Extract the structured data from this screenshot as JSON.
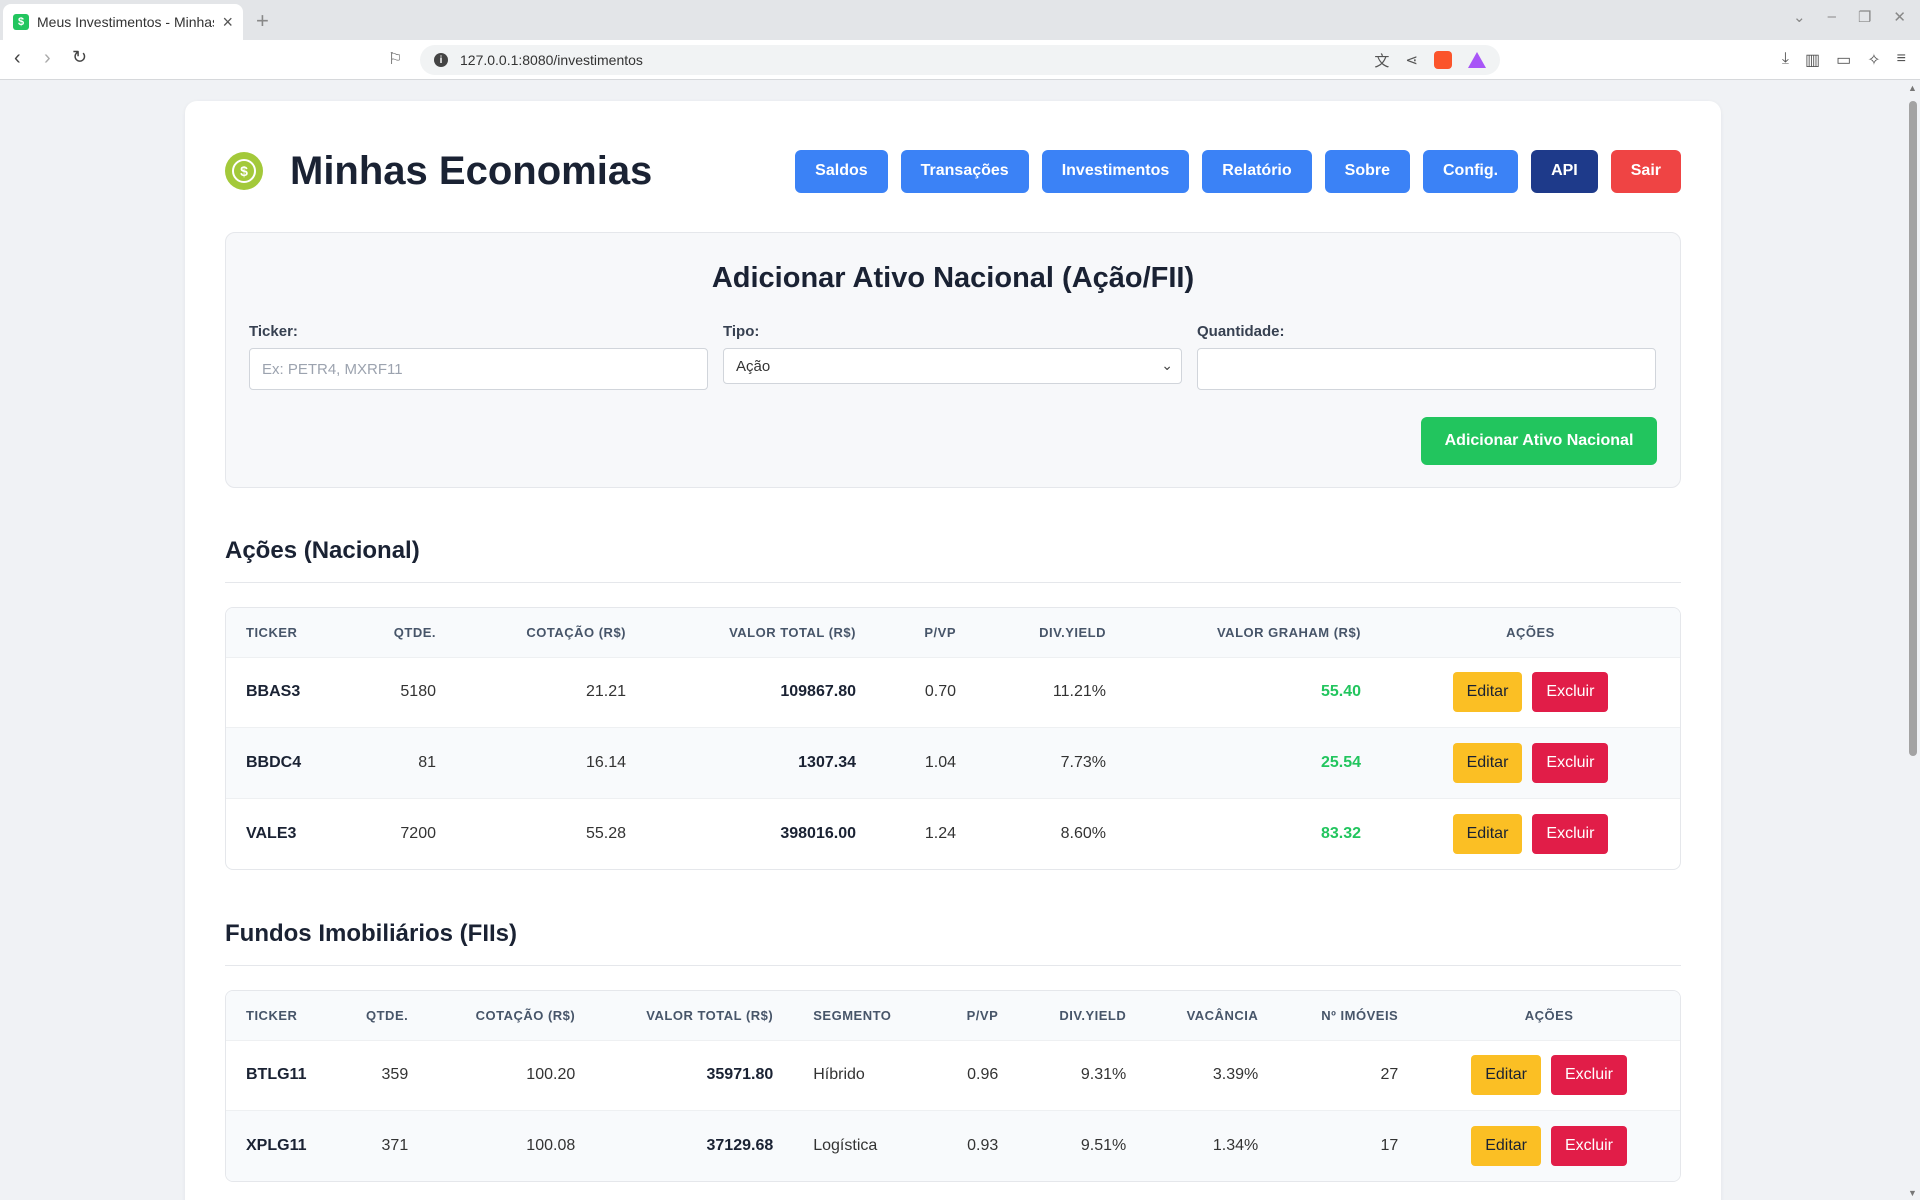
{
  "browser": {
    "tab_title": "Meus Investimentos - Minhas Economias",
    "new_tab": "+",
    "url": "127.0.0.1:8080/investimentos"
  },
  "header": {
    "title": "Minhas Economias",
    "nav": [
      "Saldos",
      "Transações",
      "Investimentos",
      "Relatório",
      "Sobre",
      "Config.",
      "API",
      "Sair"
    ]
  },
  "form": {
    "title": "Adicionar Ativo Nacional (Ação/FII)",
    "ticker_label": "Ticker:",
    "ticker_placeholder": "Ex: PETR4, MXRF11",
    "tipo_label": "Tipo:",
    "tipo_value": "Ação",
    "quantidade_label": "Quantidade:",
    "quantidade_value": "",
    "submit": "Adicionar Ativo Nacional"
  },
  "acoes": {
    "title": "Ações (Nacional)",
    "headers": [
      "TICKER",
      "QTDE.",
      "COTAÇÃO (R$)",
      "VALOR TOTAL (R$)",
      "P/VP",
      "DIV.YIELD",
      "VALOR GRAHAM (R$)",
      "AÇÕES"
    ],
    "rows": [
      {
        "ticker": "BBAS3",
        "qtde": "5180",
        "cotacao": "21.21",
        "total": "109867.80",
        "pvp": "0.70",
        "dy": "11.21%",
        "graham": "55.40"
      },
      {
        "ticker": "BBDC4",
        "qtde": "81",
        "cotacao": "16.14",
        "total": "1307.34",
        "pvp": "1.04",
        "dy": "7.73%",
        "graham": "25.54"
      },
      {
        "ticker": "VALE3",
        "qtde": "7200",
        "cotacao": "55.28",
        "total": "398016.00",
        "pvp": "1.24",
        "dy": "8.60%",
        "graham": "83.32"
      }
    ]
  },
  "fiis": {
    "title": "Fundos Imobiliários (FIIs)",
    "headers": [
      "TICKER",
      "QTDE.",
      "COTAÇÃO (R$)",
      "VALOR TOTAL (R$)",
      "SEGMENTO",
      "P/VP",
      "DIV.YIELD",
      "VACÂNCIA",
      "Nº IMÓVEIS",
      "AÇÕES"
    ],
    "rows": [
      {
        "ticker": "BTLG11",
        "qtde": "359",
        "cotacao": "100.20",
        "total": "35971.80",
        "segmento": "Híbrido",
        "pvp": "0.96",
        "dy": "9.31%",
        "vacancia": "3.39%",
        "imoveis": "27"
      },
      {
        "ticker": "XPLG11",
        "qtde": "371",
        "cotacao": "100.08",
        "total": "37129.68",
        "segmento": "Logística",
        "pvp": "0.93",
        "dy": "9.51%",
        "vacancia": "1.34%",
        "imoveis": "17"
      }
    ]
  },
  "actions": {
    "edit": "Editar",
    "delete": "Excluir"
  },
  "colors": {
    "accent": "#3b82f6",
    "api": "#1e3a8a",
    "danger": "#ef4444",
    "success": "#22c55e",
    "warning": "#fbbf24"
  }
}
